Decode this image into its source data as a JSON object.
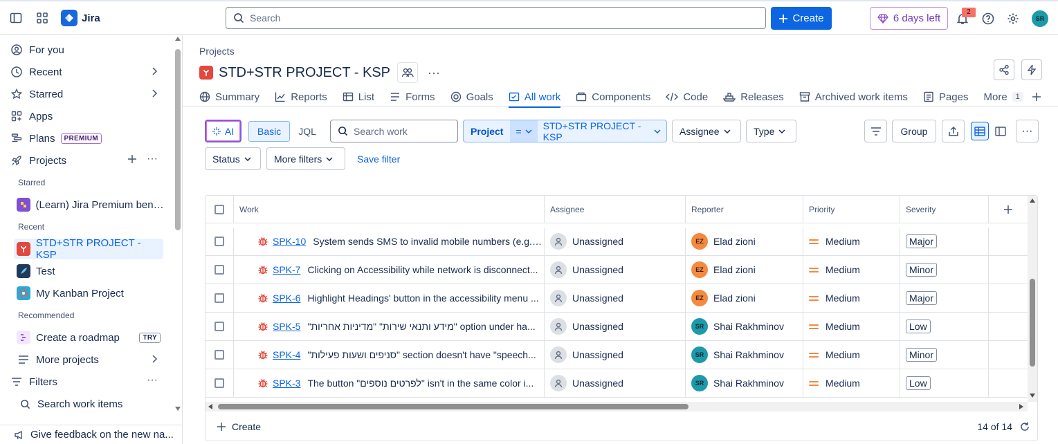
{
  "topbar": {
    "app_name": "Jira",
    "search_placeholder": "Search",
    "create_label": "Create",
    "trial_label": "6 days left",
    "notification_count": "2",
    "user_initials": "SR"
  },
  "sidebar": {
    "for_you": "For you",
    "recent": "Recent",
    "starred": "Starred",
    "apps": "Apps",
    "plans": "Plans",
    "plans_tag": "PREMIUM",
    "projects": "Projects",
    "section_starred": "Starred",
    "starred_project": "(Learn) Jira Premium bene...",
    "section_recent": "Recent",
    "recent_projects": [
      "STD+STR PROJECT - KSP",
      "Test",
      "My Kanban Project"
    ],
    "section_recommended": "Recommended",
    "create_roadmap": "Create a roadmap",
    "create_roadmap_tag": "TRY",
    "more_projects": "More projects",
    "filters": "Filters",
    "search_work_items": "Search work items",
    "feedback": "Give feedback on the new na..."
  },
  "main": {
    "breadcrumb": "Projects",
    "project_title": "STD+STR PROJECT - KSP",
    "tabs": [
      "Summary",
      "Reports",
      "List",
      "Forms",
      "Goals",
      "All work",
      "Components",
      "Code",
      "Releases",
      "Archived work items",
      "Pages"
    ],
    "active_tab": "All work",
    "more_label": "More",
    "more_count": "1"
  },
  "filters": {
    "ai_label": "AI",
    "basic_label": "Basic",
    "jql_label": "JQL",
    "search_placeholder": "Search work",
    "project_key": "Project",
    "project_op": "=",
    "project_value": "STD+STR PROJECT - KSP",
    "assignee": "Assignee",
    "type": "Type",
    "status": "Status",
    "more_filters": "More filters",
    "save_filter": "Save filter",
    "group_label": "Group"
  },
  "table": {
    "headers": {
      "work": "Work",
      "assignee": "Assignee",
      "reporter": "Reporter",
      "priority": "Priority",
      "severity": "Severity"
    },
    "rows": [
      {
        "key": "SPK-10",
        "summary": "System sends SMS to invalid mobile numbers (e.g., ...",
        "assignee": "Unassigned",
        "reporter": "Elad zioni",
        "reporter_initials": "EZ",
        "priority": "Medium",
        "severity": "Major"
      },
      {
        "key": "SPK-7",
        "summary": "Clicking on Accessibility while network is disconnect...",
        "assignee": "Unassigned",
        "reporter": "Elad zioni",
        "reporter_initials": "EZ",
        "priority": "Medium",
        "severity": "Minor"
      },
      {
        "key": "SPK-6",
        "summary": "Highlight Headings' button in the accessibility menu ...",
        "assignee": "Unassigned",
        "reporter": "Elad zioni",
        "reporter_initials": "EZ",
        "priority": "Medium",
        "severity": "Major"
      },
      {
        "key": "SPK-5",
        "summary": "\"מידע ותנאי שירות\" \"מדיניות אחריות\" option under ha...",
        "assignee": "Unassigned",
        "reporter": "Shai Rakhminov",
        "reporter_initials": "SR",
        "priority": "Medium",
        "severity": "Low"
      },
      {
        "key": "SPK-4",
        "summary": "\"סניפים ושעות פעילות\" section doesn't have \"speech...",
        "assignee": "Unassigned",
        "reporter": "Shai Rakhminov",
        "reporter_initials": "SR",
        "priority": "Medium",
        "severity": "Minor"
      },
      {
        "key": "SPK-3",
        "summary": "The button \"לפרטים נוספים\" isn't in the same color i...",
        "assignee": "Unassigned",
        "reporter": "Shai Rakhminov",
        "reporter_initials": "SR",
        "priority": "Medium",
        "severity": "Low"
      }
    ],
    "create_label": "Create",
    "count_label": "14 of 14"
  },
  "colors": {
    "primary": "#0c66e4",
    "bug": "#e2483d",
    "priority_medium": "#f38a3f"
  }
}
